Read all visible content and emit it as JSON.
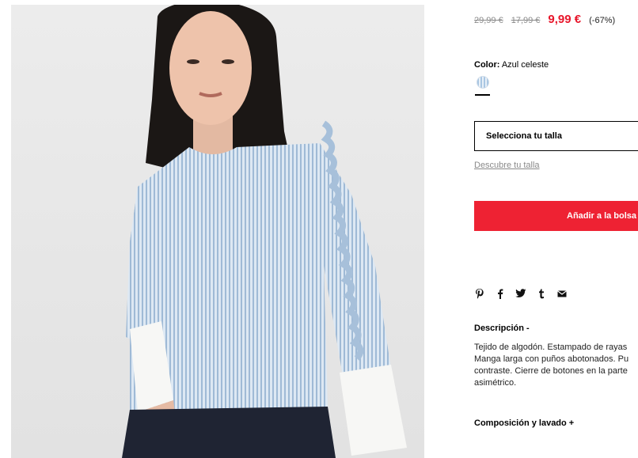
{
  "product": {
    "price_original": "29,99 €",
    "price_previous": "17,99 €",
    "price_current": "9,99 €",
    "discount": "(-67%)",
    "color_label": "Color:",
    "color_value": "Azul celeste",
    "size_select_label": "Selecciona tu talla",
    "size_guide_link": "Descubre tu talla",
    "add_to_bag_label": "Añadir a la bolsa"
  },
  "share": {
    "icons": [
      "pinterest-icon",
      "facebook-icon",
      "twitter-icon",
      "tumblr-icon",
      "email-icon"
    ]
  },
  "description": {
    "title": "Descripción -",
    "lines": [
      "Tejido de algodón. Estampado de rayas",
      "Manga larga con puños abotonados. Pu",
      "contraste. Cierre de botones en la parte",
      "asimétrico."
    ]
  },
  "composition": {
    "title": "Composición y lavado +"
  },
  "colors": {
    "price_sale": "#e8162b",
    "button_bg": "#ee2233",
    "swatch": "#a9c6e2"
  }
}
